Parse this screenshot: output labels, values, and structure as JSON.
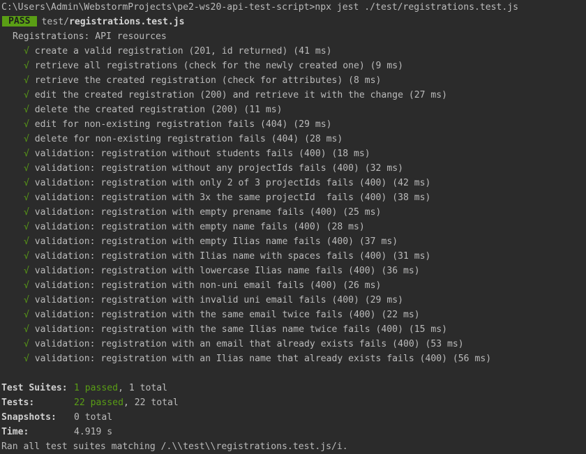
{
  "prompt": {
    "path": "C:\\Users\\Admin\\WebstormProjects\\pe2-ws20-api-test-script>",
    "command": "npx jest ./test/registrations.test.js"
  },
  "result": {
    "badge": "PASS",
    "file_dir": "test/",
    "file_name": "registrations.test.js"
  },
  "suite": {
    "title": "Registrations: API resources",
    "check_glyph": "√",
    "tests": [
      {
        "name": "create a valid registration (201, id returned)",
        "duration": "(41 ms)"
      },
      {
        "name": "retrieve all registrations (check for the newly created one)",
        "duration": "(9 ms)"
      },
      {
        "name": "retrieve the created registration (check for attributes)",
        "duration": "(8 ms)"
      },
      {
        "name": "edit the created registration (200) and retrieve it with the change",
        "duration": "(27 ms)"
      },
      {
        "name": "delete the created registration (200)",
        "duration": "(11 ms)"
      },
      {
        "name": "edit for non-existing registration fails (404)",
        "duration": "(29 ms)"
      },
      {
        "name": "delete for non-existing registration fails (404)",
        "duration": "(28 ms)"
      },
      {
        "name": "validation: registration without students fails (400)",
        "duration": "(18 ms)"
      },
      {
        "name": "validation: registration without any projectIds fails (400)",
        "duration": "(32 ms)"
      },
      {
        "name": "validation: registration with only 2 of 3 projectIds fails (400)",
        "duration": "(42 ms)"
      },
      {
        "name": "validation: registration with 3x the same projectId  fails (400)",
        "duration": "(38 ms)"
      },
      {
        "name": "validation: registration with empty prename fails (400)",
        "duration": "(25 ms)"
      },
      {
        "name": "validation: registration with empty name fails (400)",
        "duration": "(28 ms)"
      },
      {
        "name": "validation: registration with empty Ilias name fails (400)",
        "duration": "(37 ms)"
      },
      {
        "name": "validation: registration with Ilias name with spaces fails (400)",
        "duration": "(31 ms)"
      },
      {
        "name": "validation: registration with lowercase Ilias name fails (400)",
        "duration": "(36 ms)"
      },
      {
        "name": "validation: registration with non-uni email fails (400)",
        "duration": "(26 ms)"
      },
      {
        "name": "validation: registration with invalid uni email fails (400)",
        "duration": "(29 ms)"
      },
      {
        "name": "validation: registration with the same email twice fails (400)",
        "duration": "(22 ms)"
      },
      {
        "name": "validation: registration with the same Ilias name twice fails (400)",
        "duration": "(15 ms)"
      },
      {
        "name": "validation: registration with an email that already exists fails (400)",
        "duration": "(53 ms)"
      },
      {
        "name": "validation: registration with an Ilias name that already exists fails (400)",
        "duration": "(56 ms)"
      }
    ]
  },
  "summary": {
    "suites_label": "Test Suites:",
    "suites_passed": "1 passed",
    "suites_total": ", 1 total",
    "tests_label": "Tests:",
    "tests_passed": "22 passed",
    "tests_total": ", 22 total",
    "snapshots_label": "Snapshots:",
    "snapshots_value": "0 total",
    "time_label": "Time:",
    "time_value": "4.919 s",
    "ran_all": "Ran all test suites matching /.\\\\test\\\\registrations.test.js/i."
  },
  "colors": {
    "background": "#2b2b2b",
    "text": "#bbbbbb",
    "pass_green": "#5a9e15"
  }
}
